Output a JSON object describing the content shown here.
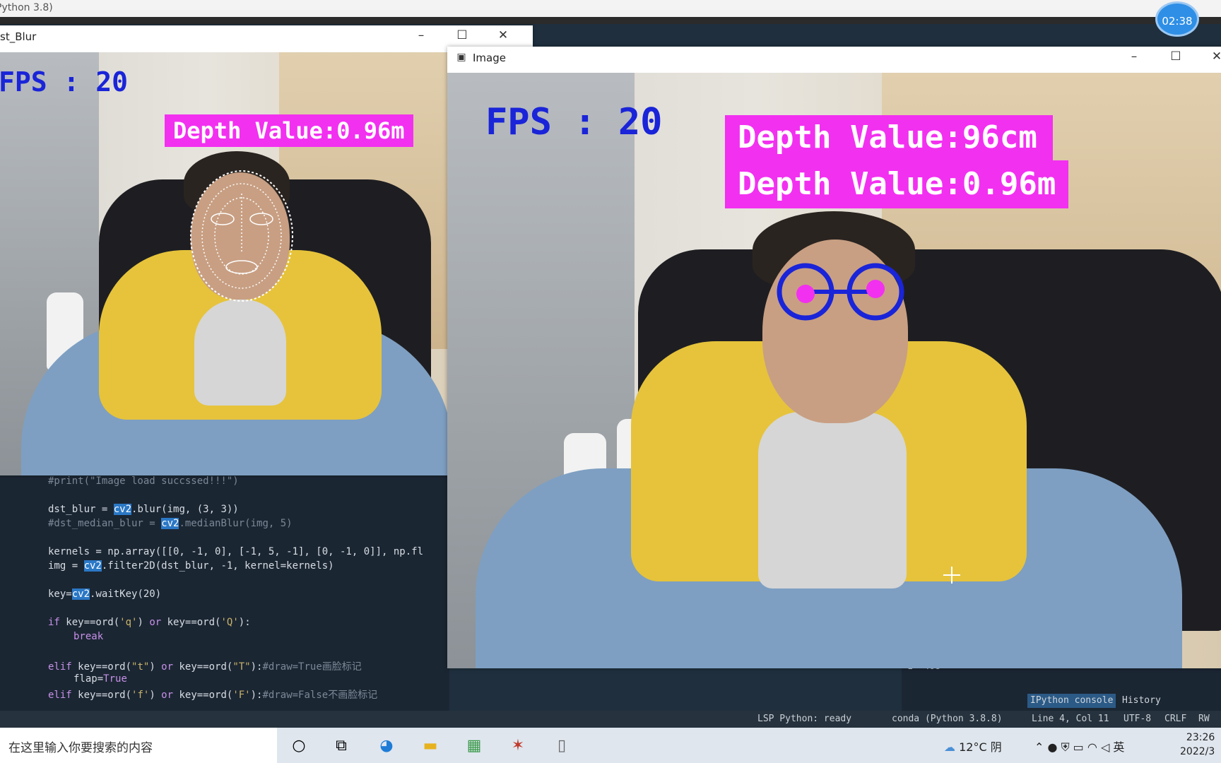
{
  "ide": {
    "title_fragment": "Python 3.8)"
  },
  "clock_overlay": "02:38",
  "blur_window": {
    "title": "st_Blur",
    "fps_label": "FPS : 20",
    "depth_label": "Depth Value:0.96m"
  },
  "image_window": {
    "title": "Image",
    "fps_label": "FPS : 20",
    "depth_cm_label": "Depth Value:96cm",
    "depth_m_label": "Depth Value:0.96m"
  },
  "code": {
    "lines": [
      "#print(\"Image load succssed!!!\")",
      "dst_blur = cv2.blur(img, (3, 3))",
      "#dst_median_blur = cv2.medianBlur(img, 5)",
      "kernels = np.array([[0, -1, 0], [-1, 5, -1], [0, -1, 0]], np.fl",
      "img = cv2.filter2D(dst_blur, -1, kernel=kernels)",
      "key=cv2.waitKey(20)",
      "if key==ord('q') or key==ord('Q'):",
      "break",
      "elif key==ord(\"t\") or key==ord(\"T\"):#draw=True画脸标记",
      "flap=True",
      "elif key==ord('f') or key==ord('F'):#draw=False不画脸标记"
    ]
  },
  "console": {
    "fragment": "1- 408",
    "tabs": [
      "IPython console",
      "History"
    ]
  },
  "status_bar": {
    "lsp": "LSP Python: ready",
    "conda": "conda (Python 3.8.8)",
    "cursor": "Line 4, Col 11",
    "encoding": "UTF-8",
    "eol": "CRLF",
    "mode": "RW"
  },
  "taskbar": {
    "search_placeholder": "在这里输入你要搜索的内容",
    "weather": "12°C 阴",
    "ime": "英",
    "time": "23:26",
    "date": "2022/3"
  },
  "colors": {
    "fps_text": "#1a24d8",
    "depth_box": "#f230f0",
    "eye_ring": "#1a24d8",
    "pupil": "#f230f0"
  }
}
